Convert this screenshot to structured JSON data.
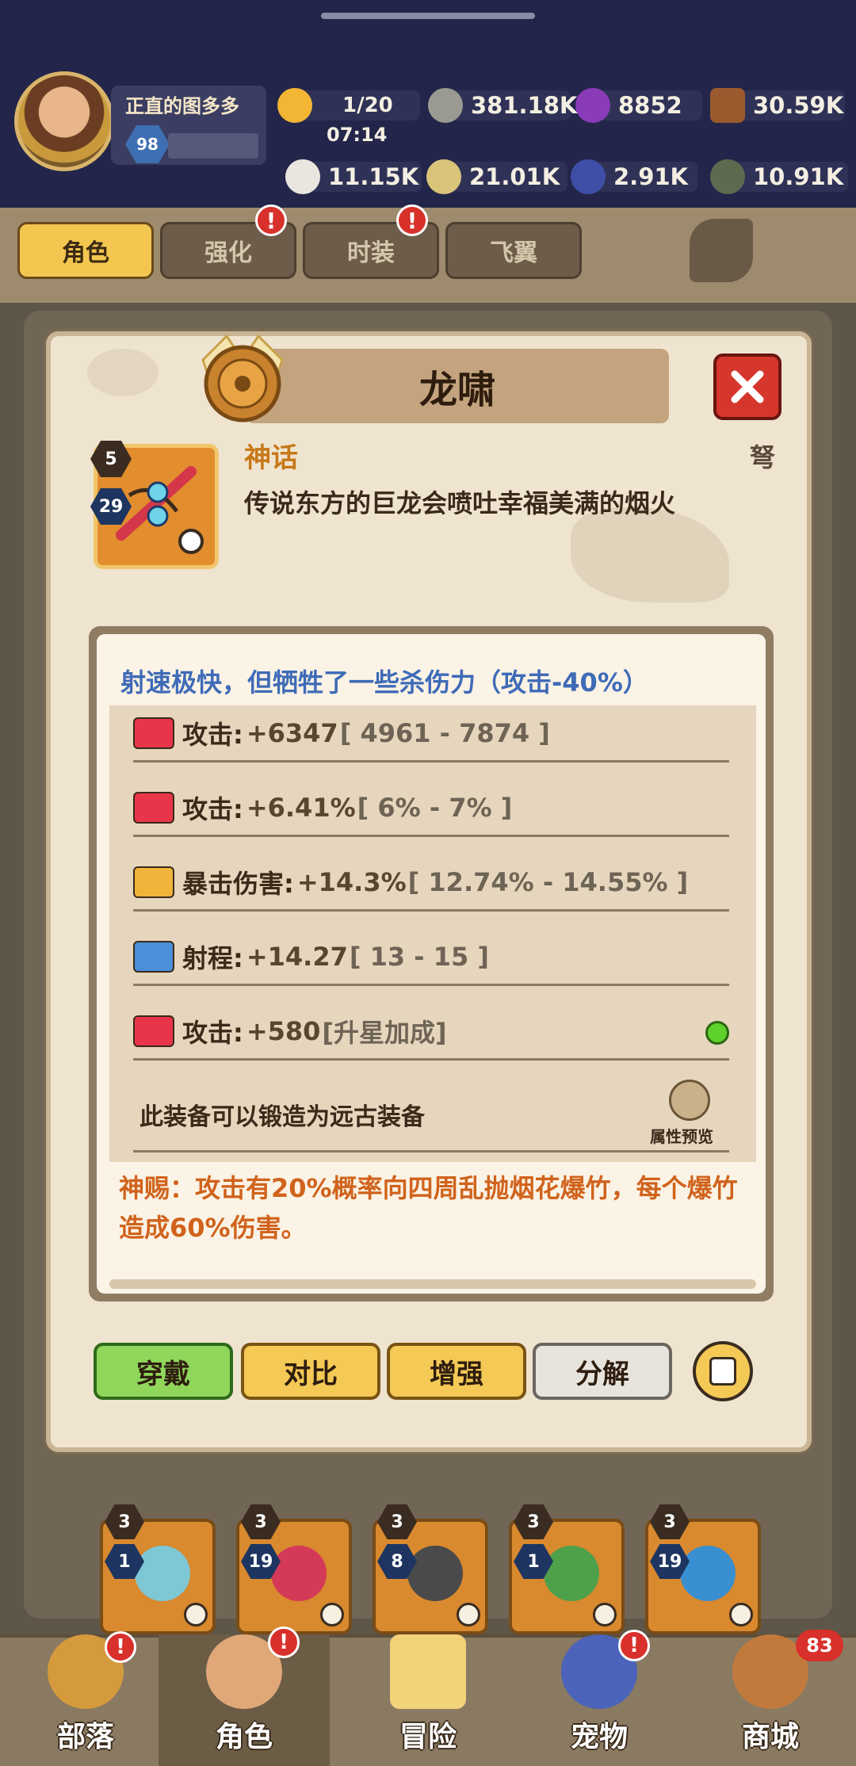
{
  "player": {
    "name": "正直的图多多",
    "level": "98"
  },
  "resources": {
    "stamina": "1/20",
    "stamina_timer": "07:14",
    "stone": "381.18K",
    "gem_purple": "8852",
    "wood": "30.59K",
    "bone": "11.15K",
    "coin": "21.01K",
    "crystal": "2.91K",
    "ore": "10.91K"
  },
  "tabs": [
    {
      "label": "角色",
      "active": true
    },
    {
      "label": "强化",
      "alert": "!"
    },
    {
      "label": "时装",
      "alert": "!"
    },
    {
      "label": "飞翼"
    }
  ],
  "modal": {
    "title": "龙啸",
    "close_icon": "close-icon",
    "item_star": "5",
    "item_level": "29",
    "rarity": "神话",
    "weapon_type": "弩",
    "description": "传说东方的巨龙会喷吐幸福美满的烟火",
    "speed_note": "射速极快，但牺牲了一些杀伤力（攻击-40%）",
    "stats": [
      {
        "name": "攻击:",
        "value": "+6347",
        "range": "[ 4961 - 7874 ]",
        "icon": "attack-icon",
        "color": "#e8354a"
      },
      {
        "name": "攻击:",
        "value": "+6.41%",
        "range": "[ 6% - 7% ]",
        "icon": "attack-icon",
        "color": "#e8354a"
      },
      {
        "name": "暴击伤害:",
        "value": "+14.3%",
        "range": "[ 12.74% - 14.55% ]",
        "icon": "crit-icon",
        "color": "#f0b43a"
      },
      {
        "name": "射程:",
        "value": "+14.27",
        "range": "[ 13 - 15 ]",
        "icon": "range-icon",
        "color": "#4a8fd8"
      },
      {
        "name": "攻击:",
        "value": "+580",
        "range": "[升星加成]",
        "icon": "attack-icon",
        "color": "#e8354a"
      }
    ],
    "forge_text": "此装备可以锻造为远古装备",
    "preview_label": "属性预览",
    "divine": "神赐：攻击有20%概率向四周乱抛烟花爆竹，每个爆竹造成60%伤害。",
    "buttons": {
      "equip": "穿戴",
      "compare": "对比",
      "enhance": "增强",
      "decompose": "分解"
    }
  },
  "inventory_slots": [
    {
      "star": "3",
      "level": "1"
    },
    {
      "star": "3",
      "level": "19"
    },
    {
      "star": "3",
      "level": "8"
    },
    {
      "star": "3",
      "level": "1"
    },
    {
      "star": "3",
      "level": "19"
    }
  ],
  "bottom_nav": [
    {
      "label": "部落",
      "alert": "!"
    },
    {
      "label": "角色",
      "active": true,
      "alert": "!"
    },
    {
      "label": "冒险"
    },
    {
      "label": "宠物",
      "alert": "!"
    },
    {
      "label": "商城",
      "count": "83"
    }
  ]
}
